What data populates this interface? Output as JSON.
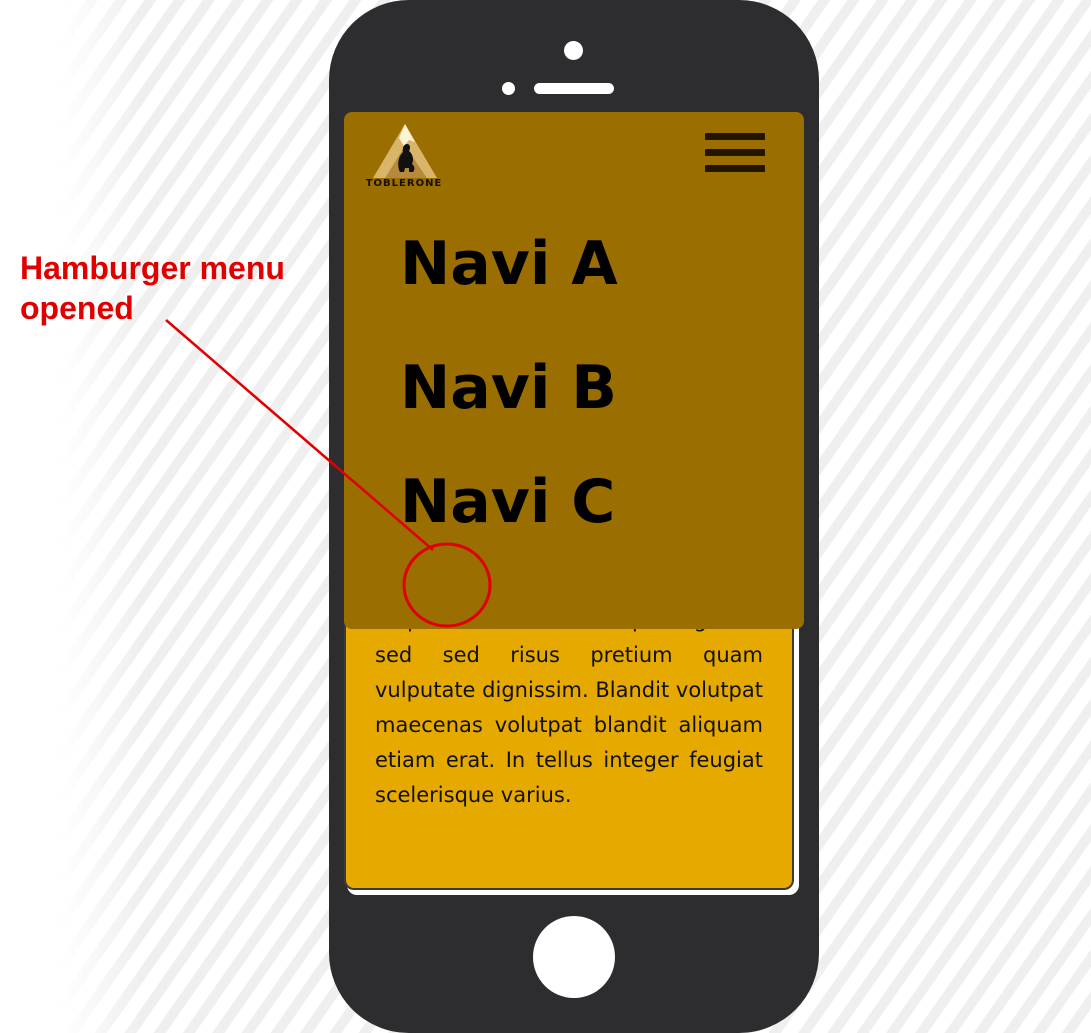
{
  "annotation": {
    "label": "Hamburger menu\nopened",
    "color": "#e00000"
  },
  "app": {
    "logo_text": "TOBLERONE",
    "menu_icon": "hamburger-icon",
    "nav_items": [
      {
        "label": "Navi A"
      },
      {
        "label": "Navi B"
      },
      {
        "label": "Navi C"
      }
    ],
    "body_text": "aliquet elementum tempus egestas sed sed risus pretium quam vulputate dignissim. Blandit volutpat maecenas volutpat blandit aliquam etiam erat. In tellus integer feugiat scelerisque varius."
  },
  "colors": {
    "phone_body": "#2d2d2f",
    "menu_panel": "#9a6e00",
    "content_card": "#e6a900",
    "annotation": "#e00000"
  }
}
